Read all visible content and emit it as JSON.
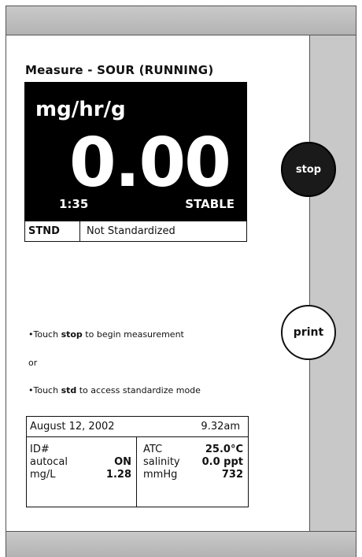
{
  "header": {
    "title": "Measure - SOUR (RUNNING)"
  },
  "display": {
    "unit": "mg/hr/g",
    "reading": "0.00",
    "elapsed": "1:35",
    "state": "STABLE"
  },
  "standard": {
    "code": "STND",
    "status": "Not Standardized"
  },
  "buttons": {
    "stop_label": "stop",
    "print_label": "print"
  },
  "instructions": {
    "line1_prefix": "•Touch ",
    "line1_bold": "stop",
    "line1_suffix": " to begin measurement",
    "or": "or",
    "line2_prefix": "•Touch ",
    "line2_bold": "std",
    "line2_suffix": " to access standardize mode"
  },
  "info": {
    "date": "August 12, 2002",
    "time": "9.32am",
    "left": [
      {
        "label": "ID#",
        "value": ""
      },
      {
        "label": "autocal",
        "value": "ON"
      },
      {
        "label": "mg/L",
        "value": "1.28"
      }
    ],
    "right": [
      {
        "label": "ATC",
        "value": "25.0°C"
      },
      {
        "label": "salinity",
        "value": "0.0 ppt"
      },
      {
        "label": "mmHg",
        "value": "732"
      }
    ]
  },
  "colors": {
    "frame": "#b3b3b3",
    "side_strip": "#c8c8c8",
    "display_bg": "#000000",
    "display_text": "#ffffff"
  }
}
